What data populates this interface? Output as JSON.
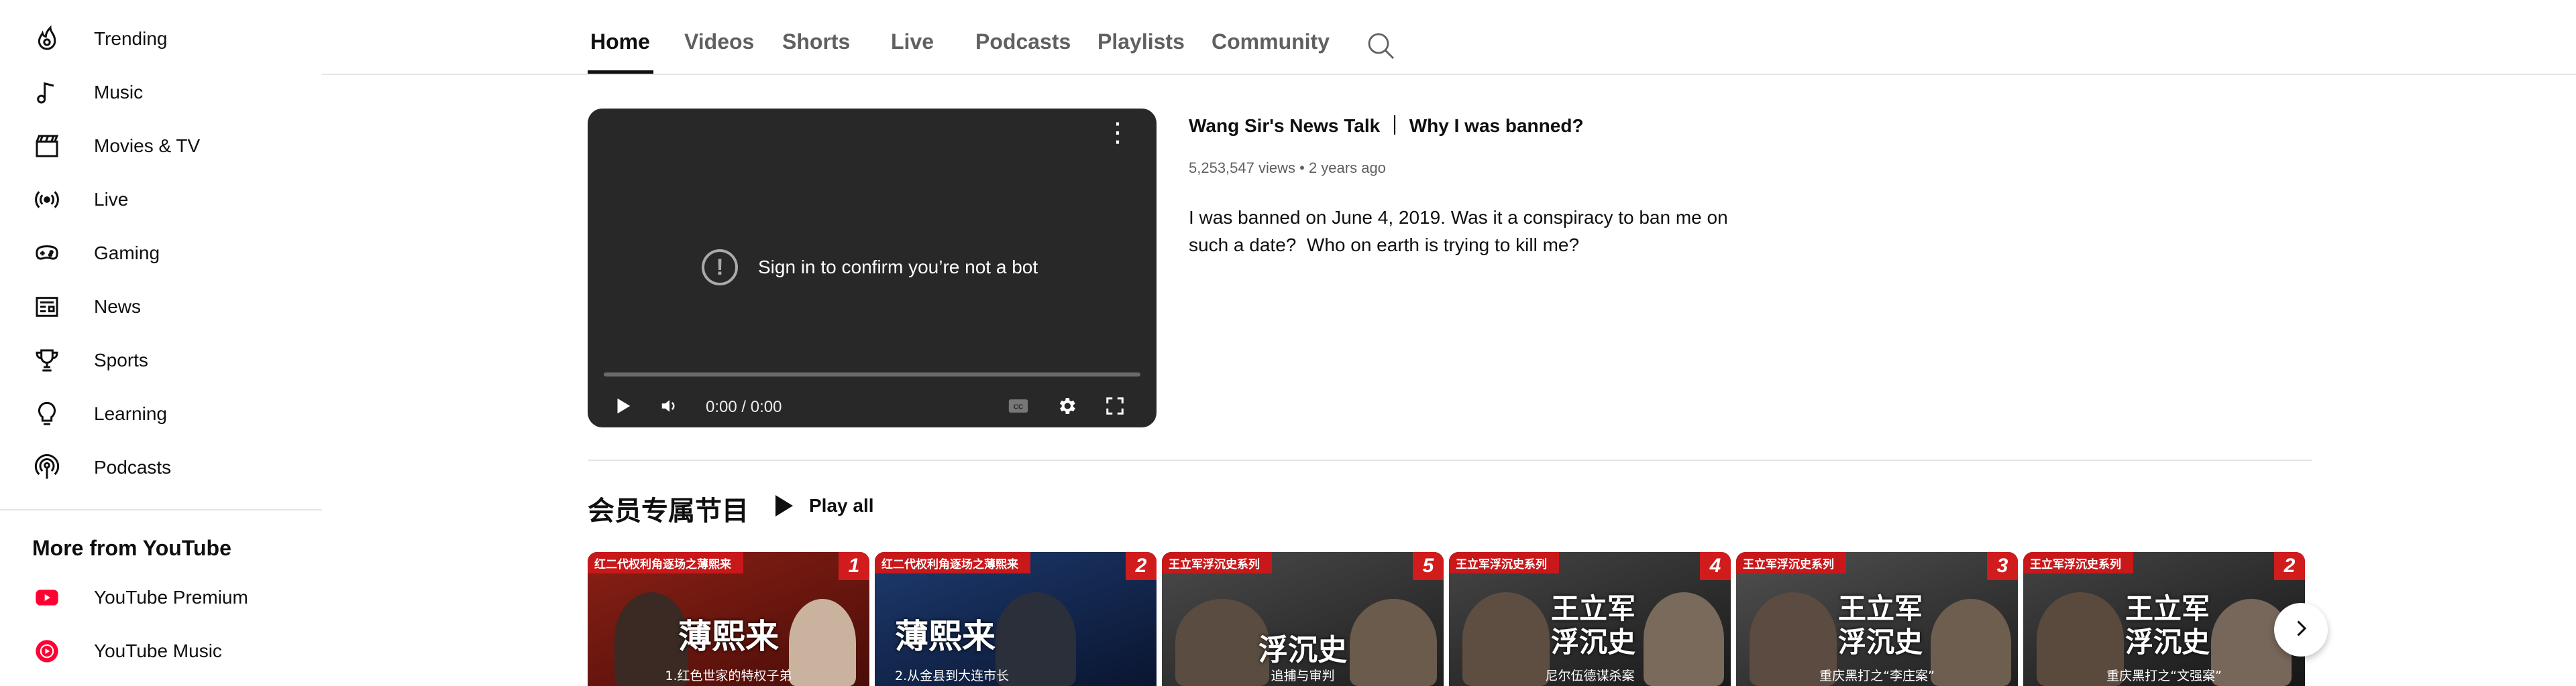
{
  "sidebar": {
    "items": [
      {
        "label": "Trending",
        "icon": "trending-icon"
      },
      {
        "label": "Music",
        "icon": "music-note-icon"
      },
      {
        "label": "Movies & TV",
        "icon": "clapperboard-icon"
      },
      {
        "label": "Live",
        "icon": "live-broadcast-icon"
      },
      {
        "label": "Gaming",
        "icon": "gamepad-icon"
      },
      {
        "label": "News",
        "icon": "newspaper-icon"
      },
      {
        "label": "Sports",
        "icon": "trophy-icon"
      },
      {
        "label": "Learning",
        "icon": "lightbulb-icon"
      },
      {
        "label": "Podcasts",
        "icon": "podcast-icon"
      }
    ],
    "more_heading": "More from YouTube",
    "more_items": [
      {
        "label": "YouTube Premium",
        "icon": "youtube-premium-icon"
      },
      {
        "label": "YouTube Music",
        "icon": "youtube-music-icon"
      }
    ]
  },
  "tabs": [
    {
      "label": "Home",
      "active": true
    },
    {
      "label": "Videos",
      "active": false
    },
    {
      "label": "Shorts",
      "active": false
    },
    {
      "label": "Live",
      "active": false
    },
    {
      "label": "Podcasts",
      "active": false
    },
    {
      "label": "Playlists",
      "active": false
    },
    {
      "label": "Community",
      "active": false
    }
  ],
  "player": {
    "message": "Sign in to confirm you’re not a bot",
    "time": "0:00 / 0:00"
  },
  "video": {
    "title": "Wang Sir's News Talk  ｜ Why I was banned?",
    "views": "5,253,547 views",
    "age": "2 years ago",
    "description": "I was banned on June 4, 2019. Was it a conspiracy to ban me on such a date?  Who on earth is trying to kill me?"
  },
  "shelf": {
    "title": "会员专属节目",
    "play_all": "Play all",
    "thumbnails": [
      {
        "series": "红二代权利角逐场之薄熙来",
        "number": "1",
        "headline": "薄熙来",
        "subtitle": "1.红色世家的特权子弟",
        "bg": "#6e1a12"
      },
      {
        "series": "红二代权利角逐场之薄熙来",
        "number": "2",
        "headline": "薄熙来",
        "subtitle": "2.从金县到大连市长",
        "bg": "#13284f"
      },
      {
        "series": "王立军浮沉史系列",
        "number": "5",
        "headline": "浮沉史",
        "subtitle": "追捕与审判",
        "bg": "#3a3a3a"
      },
      {
        "series": "王立军浮沉史系列",
        "number": "4",
        "headline": "王立军 浮沉史",
        "subtitle": "尼尔伍德谋杀案",
        "bg": "#2e2e2e"
      },
      {
        "series": "王立军浮沉史系列",
        "number": "3",
        "headline": "王立军 浮沉史",
        "subtitle": "重庆黑打之“李庄案”",
        "bg": "#353535"
      },
      {
        "series": "王立军浮沉史系列",
        "number": "2",
        "headline": "王立军 浮沉史",
        "subtitle": "重庆黑打之“文强案”",
        "bg": "#2a2a2a"
      }
    ]
  },
  "colors": {
    "accent_red": "#d01c1c",
    "youtube_red": "#ff0033",
    "text_primary": "#0f0f0f",
    "text_secondary": "#606060"
  }
}
